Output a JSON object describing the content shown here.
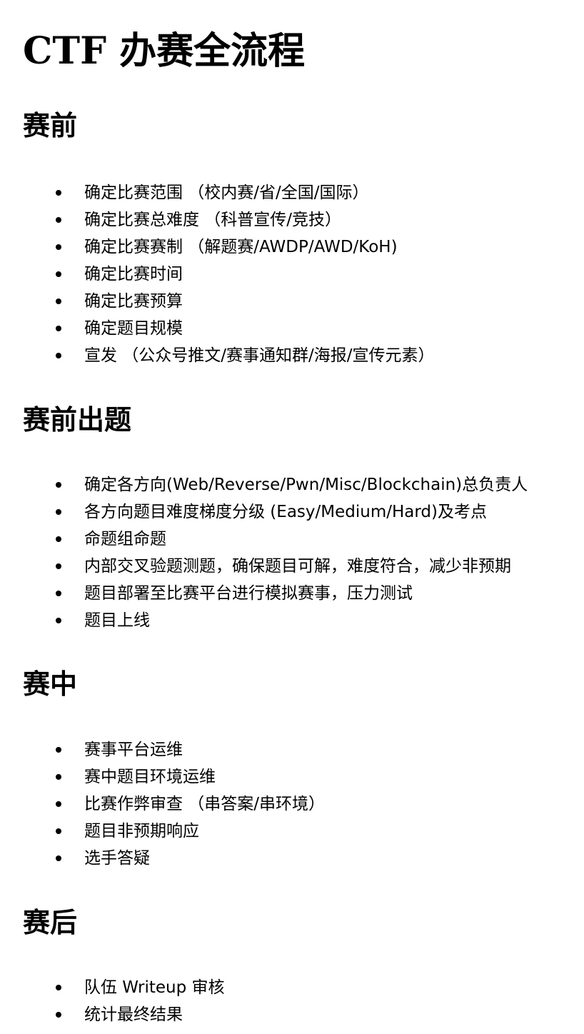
{
  "document": {
    "title": "CTF 办赛全流程",
    "sections": [
      {
        "heading": "赛前",
        "items": [
          "确定比赛范围 （校内赛/省/全国/国际）",
          "确定比赛总难度 （科普宣传/竞技）",
          "确定比赛赛制 （解题赛/AWDP/AWD/KoH)",
          "确定比赛时间",
          "确定比赛预算",
          "确定题目规模",
          "宣发 （公众号推文/赛事通知群/海报/宣传元素）"
        ]
      },
      {
        "heading": "赛前出题",
        "items": [
          "确定各方向(Web/Reverse/Pwn/Misc/Blockchain)总负责人",
          "各方向题目难度梯度分级 (Easy/Medium/Hard)及考点",
          "命题组命题",
          "内部交叉验题测题，确保题目可解，难度符合，减少非预期",
          "题目部署至比赛平台进行模拟赛事，压力测试",
          "题目上线"
        ]
      },
      {
        "heading": "赛中",
        "items": [
          "赛事平台运维",
          "赛中题目环境运维",
          "比赛作弊审查 （串答案/串环境）",
          "题目非预期响应",
          "选手答疑"
        ]
      },
      {
        "heading": "赛后",
        "items": [
          "队伍 Writeup 审核",
          "统计最终结果"
        ]
      }
    ]
  }
}
